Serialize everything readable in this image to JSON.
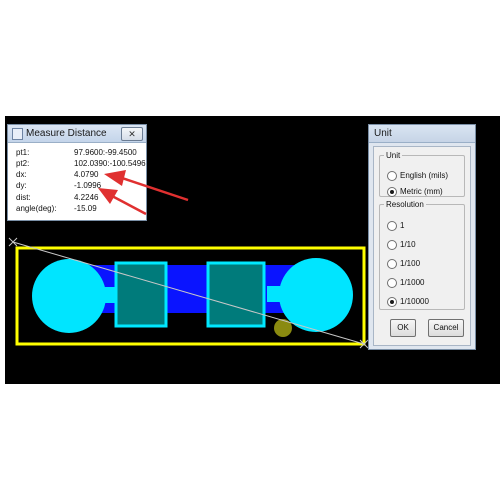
{
  "measure_window": {
    "title": "Measure Distance",
    "close_label": "✕",
    "rows": [
      {
        "label": "pt1:",
        "value": "97.9600:-99.4500"
      },
      {
        "label": "pt2:",
        "value": "102.0390:-100.5496"
      },
      {
        "label": "dx:",
        "value": "4.0790"
      },
      {
        "label": "dy:",
        "value": "-1.0996"
      },
      {
        "label": "dist:",
        "value": "4.2246"
      },
      {
        "label": "angle(deg):",
        "value": "-15.09"
      }
    ]
  },
  "unit_window": {
    "title": "Unit",
    "unit_group": {
      "label": "Unit",
      "options": [
        {
          "label": "English (mils)",
          "selected": false
        },
        {
          "label": "Metric (mm)",
          "selected": true
        }
      ]
    },
    "resolution_group": {
      "label": "Resolution",
      "options": [
        {
          "label": "1",
          "selected": false
        },
        {
          "label": "1/10",
          "selected": false
        },
        {
          "label": "1/100",
          "selected": false
        },
        {
          "label": "1/1000",
          "selected": false
        },
        {
          "label": "1/10000",
          "selected": true
        }
      ]
    },
    "ok_label": "OK",
    "cancel_label": "Cancel"
  },
  "colors": {
    "canvas_bg": "#000000",
    "selection_box": "#ffff00",
    "pad_fill": "#00e5ff",
    "copper": "#0a14ff",
    "component_fill": "#007b7b",
    "component_outline": "#00e8ff",
    "via": "#8a8a10",
    "measure_line": "#c8c8c8",
    "annotation_arrow": "#e03030"
  }
}
